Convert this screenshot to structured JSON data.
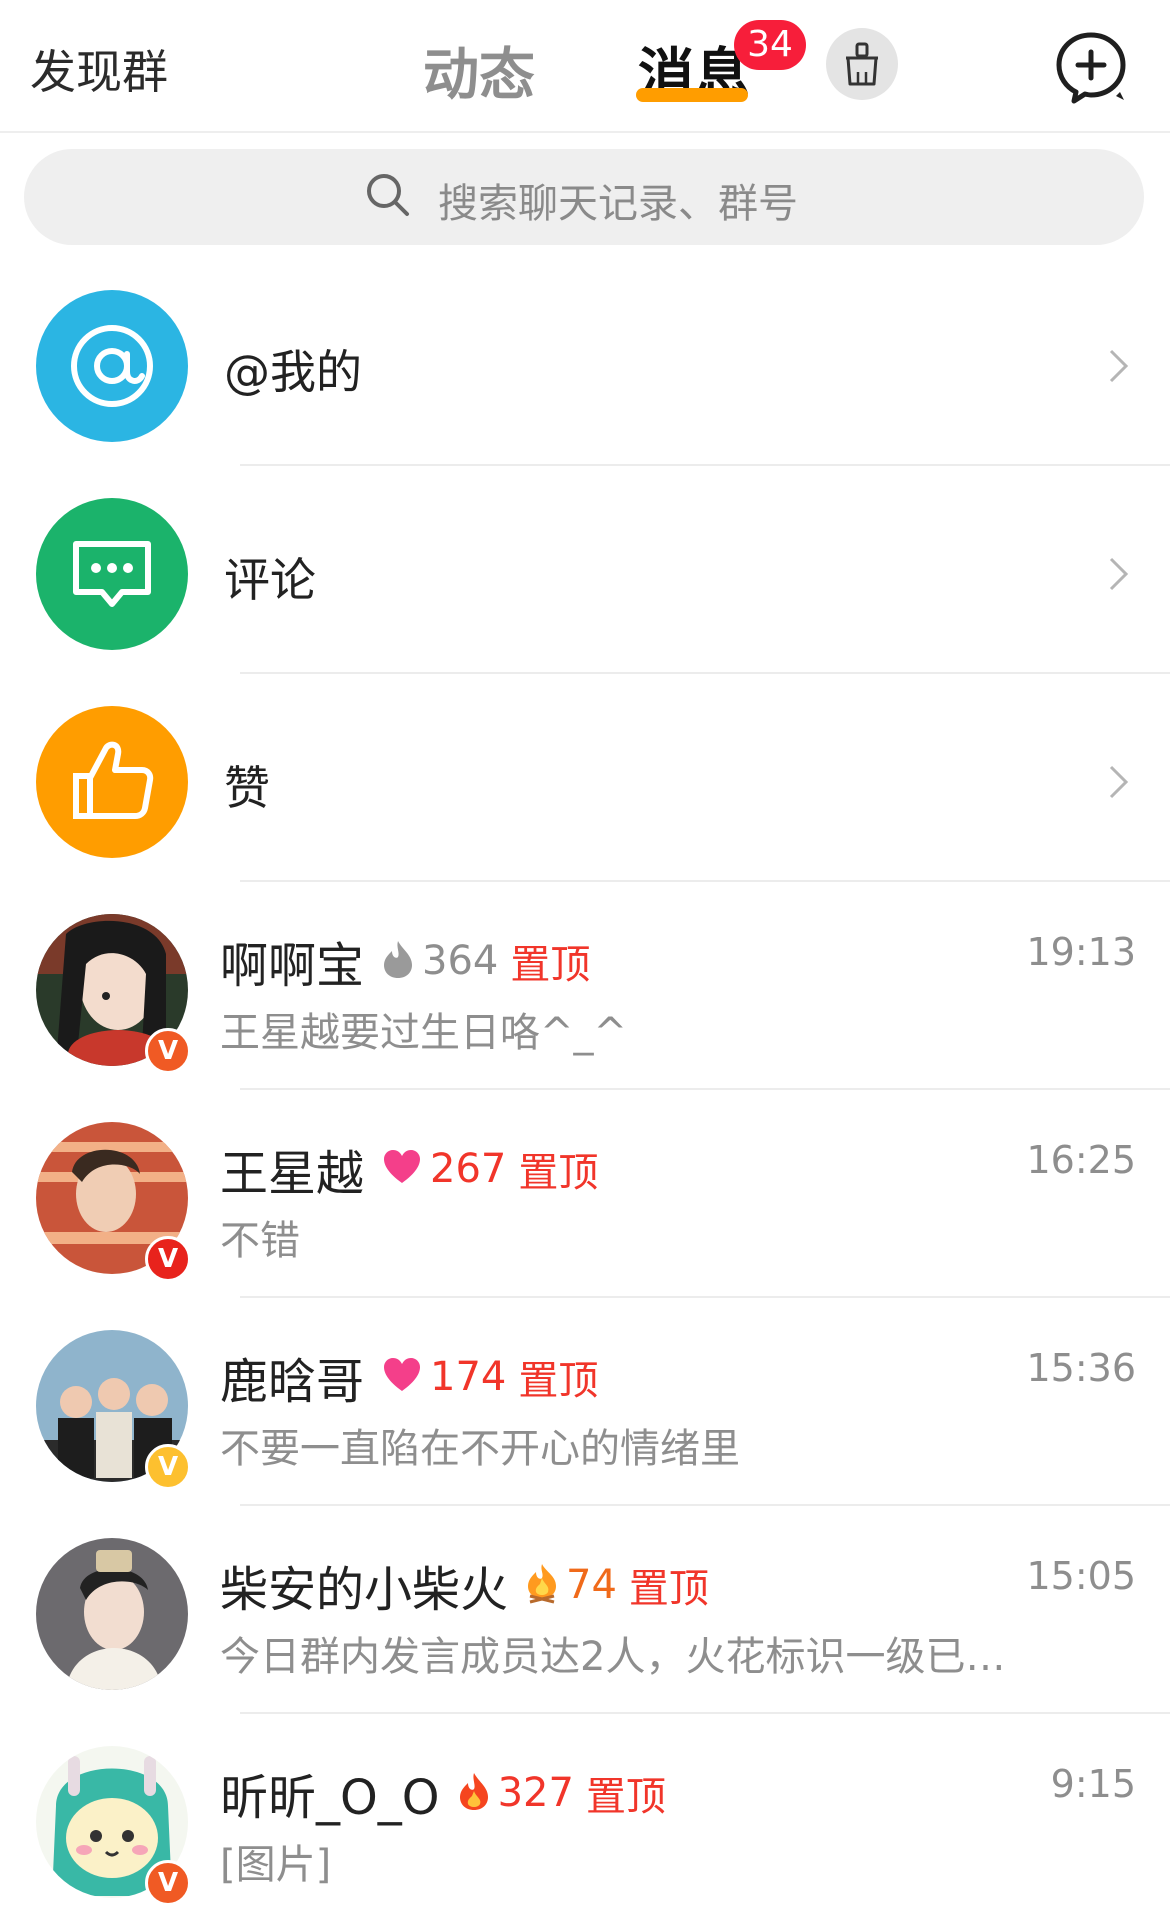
{
  "header": {
    "discover_label": "发现群",
    "tabs": [
      {
        "label": "动态",
        "active": false
      },
      {
        "label": "消息",
        "active": true
      }
    ],
    "badge_count": "34",
    "accent_color": "#ff9d00",
    "badge_color": "#f71e3a"
  },
  "search": {
    "placeholder": "搜索聊天记录、群号"
  },
  "entries": [
    {
      "label": "@我的",
      "icon": "at-icon",
      "color": "#2bb5e3"
    },
    {
      "label": "评论",
      "icon": "comment-icon",
      "color": "#1bb36b"
    },
    {
      "label": "赞",
      "icon": "thumbs-up-icon",
      "color": "#ff9d00"
    }
  ],
  "chats": [
    {
      "name": "啊啊宝",
      "flag_icon": "gray-flame-icon",
      "count": "364",
      "count_color": "#8e8e8e",
      "pin": "置顶",
      "time": "19:13",
      "preview": "王星越要过生日咯^_^",
      "verified_color": "#f05a24"
    },
    {
      "name": "王星越",
      "flag_icon": "heart-icon",
      "count": "267",
      "count_color": "#f1352a",
      "pin": "置顶",
      "time": "16:25",
      "preview": "不错",
      "verified_color": "#e8231c"
    },
    {
      "name": "鹿晗哥",
      "flag_icon": "heart-icon",
      "count": "174",
      "count_color": "#f1352a",
      "pin": "置顶",
      "time": "15:36",
      "preview": "不要一直陷在不开心的情绪里",
      "verified_color": "#fdc02f"
    },
    {
      "name": "柴安的小柴火",
      "flag_icon": "campfire-icon",
      "count": "74",
      "count_color": "#f06a1a",
      "pin": "置顶",
      "time": "15:05",
      "preview": "今日群内发言成员达2人，火花标识一级已…",
      "verified_color": ""
    },
    {
      "name": "昕昕_O_O",
      "flag_icon": "fire-icon",
      "count": "327",
      "count_color": "#f1352a",
      "pin": "置顶",
      "time": "9:15",
      "preview": "[图片]",
      "verified_color": "#f05a24"
    }
  ]
}
